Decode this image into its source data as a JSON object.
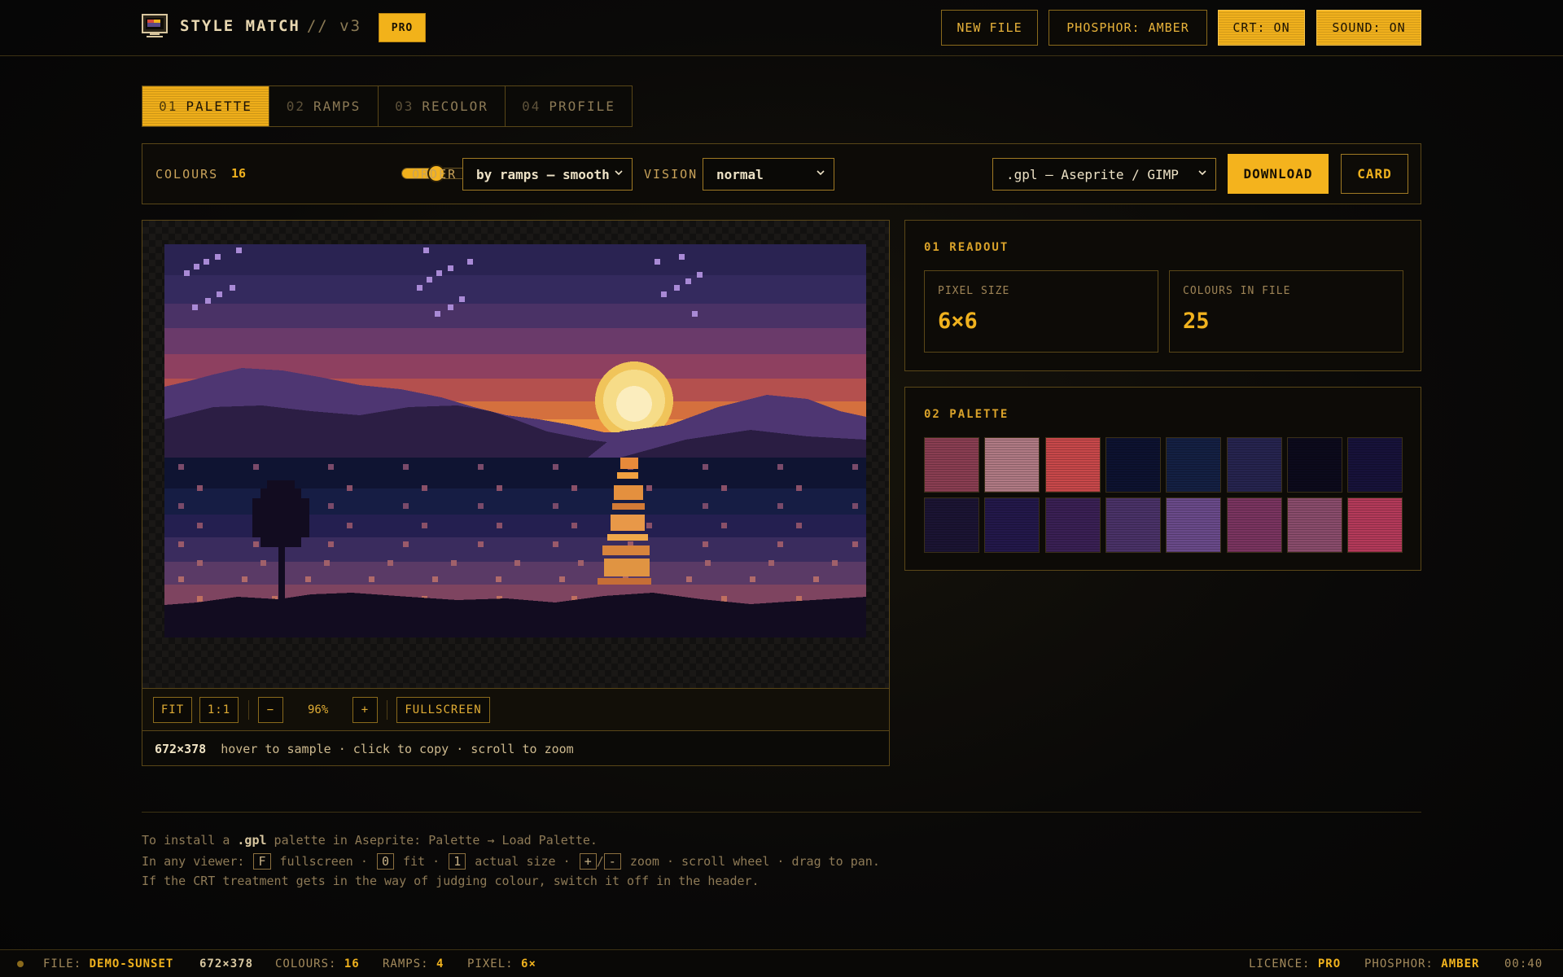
{
  "header": {
    "brand_name": "STYLE MATCH",
    "brand_version": "// v3",
    "badge": "PRO",
    "buttons": {
      "new_file": "NEW FILE",
      "phosphor": "PHOSPHOR: AMBER",
      "crt": "CRT: ON",
      "sound": "SOUND: ON"
    }
  },
  "tabs": [
    {
      "num": "01",
      "label": "PALETTE",
      "active": true
    },
    {
      "num": "02",
      "label": "RAMPS",
      "active": false
    },
    {
      "num": "03",
      "label": "RECOLOR",
      "active": false
    },
    {
      "num": "04",
      "label": "PROFILE",
      "active": false
    }
  ],
  "toolbar": {
    "colours_label": "COLOURS",
    "colours_value": "16",
    "colours_slider_fraction": 0.18,
    "order_label": "ORDER",
    "order_value": "by ramps — smooth",
    "vision_label": "VISION",
    "vision_value": "normal",
    "format_value": ".gpl — Aseprite / GIMP",
    "download_label": "DOWNLOAD",
    "card_label": "CARD"
  },
  "viewer": {
    "zoom": {
      "fit": "FIT",
      "one_to_one": "1:1",
      "minus": "−",
      "percent": "96%",
      "plus": "+",
      "fullscreen": "FULLSCREEN"
    },
    "dimensions": "672×378",
    "hint": "hover to sample · click to copy · scroll to zoom"
  },
  "readout": {
    "title": "01 READOUT",
    "pixel_size_label": "PIXEL SIZE",
    "pixel_size_value": "6×6",
    "colours_in_file_label": "COLOURS IN FILE",
    "colours_in_file_value": "25"
  },
  "palette": {
    "title": "02 PALETTE",
    "swatches": [
      "#8a3e52",
      "#b07a84",
      "#c8484a",
      "#0d1230",
      "#142043",
      "#26244f",
      "#0c0a1c",
      "#17123a",
      "#1b1433",
      "#23184a",
      "#3a2054",
      "#4a3268",
      "#6a4a8a",
      "#7a3460",
      "#8a4c6c",
      "#b43a5a"
    ]
  },
  "help": {
    "line1_a": "To install a ",
    "line1_b": ".gpl",
    "line1_c": " palette in Aseprite: Palette → Load Palette.",
    "line2_a": "In any viewer:",
    "line2_k1": "F",
    "line2_t1": "fullscreen ·",
    "line2_k2": "0",
    "line2_t2": "fit ·",
    "line2_k3": "1",
    "line2_t3": "actual size ·",
    "line2_k4": "+",
    "line2_slash": "/",
    "line2_k5": "-",
    "line2_t4": "zoom · scroll wheel · drag to pan.",
    "line3": "If the CRT treatment gets in the way of judging colour, switch it off in the header."
  },
  "status": {
    "file_label": "FILE:",
    "file_value": "DEMO-SUNSET",
    "dims": "672×378",
    "colours_label": "COLOURS:",
    "colours_value": "16",
    "ramps_label": "RAMPS:",
    "ramps_value": "4",
    "pixel_label": "PIXEL:",
    "pixel_value": "6×",
    "licence_label": "LICENCE:",
    "licence_value": "PRO",
    "phosphor_label": "PHOSPHOR:",
    "phosphor_value": "AMBER",
    "time": "00:40"
  }
}
